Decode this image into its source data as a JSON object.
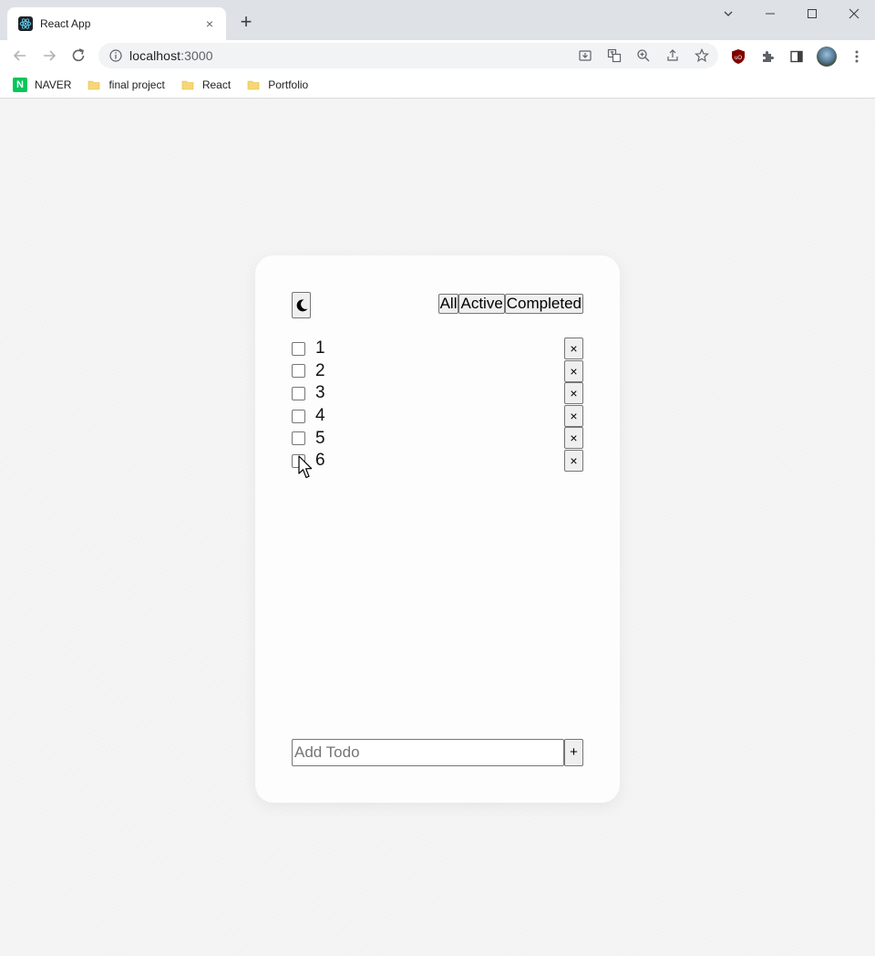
{
  "browser": {
    "tab_title": "React App",
    "tab_close": "×",
    "new_tab": "+",
    "url_host": "localhost",
    "url_port": ":3000",
    "bookmarks": [
      {
        "label": "NAVER",
        "badge": "N",
        "icon": "naver-icon"
      },
      {
        "label": "final project",
        "icon": "folder-icon"
      },
      {
        "label": "React",
        "icon": "folder-icon"
      },
      {
        "label": "Portfolio",
        "icon": "folder-icon"
      }
    ],
    "colors": {
      "tabstrip": "#dee1e6",
      "naver": "#03c75a",
      "folder": "#f7d774"
    }
  },
  "app": {
    "theme_toggle_icon": "moon-icon",
    "filters": [
      {
        "label": "All"
      },
      {
        "label": "Active"
      },
      {
        "label": "Completed"
      }
    ],
    "todos": [
      {
        "text": "1",
        "completed": false,
        "delete_label": "×"
      },
      {
        "text": "2",
        "completed": false,
        "delete_label": "×"
      },
      {
        "text": "3",
        "completed": false,
        "delete_label": "×"
      },
      {
        "text": "4",
        "completed": false,
        "delete_label": "×"
      },
      {
        "text": "5",
        "completed": false,
        "delete_label": "×"
      },
      {
        "text": "6",
        "completed": false,
        "delete_label": "×"
      }
    ],
    "add_form": {
      "placeholder": "Add Todo",
      "value": "",
      "submit_label": "+"
    }
  }
}
